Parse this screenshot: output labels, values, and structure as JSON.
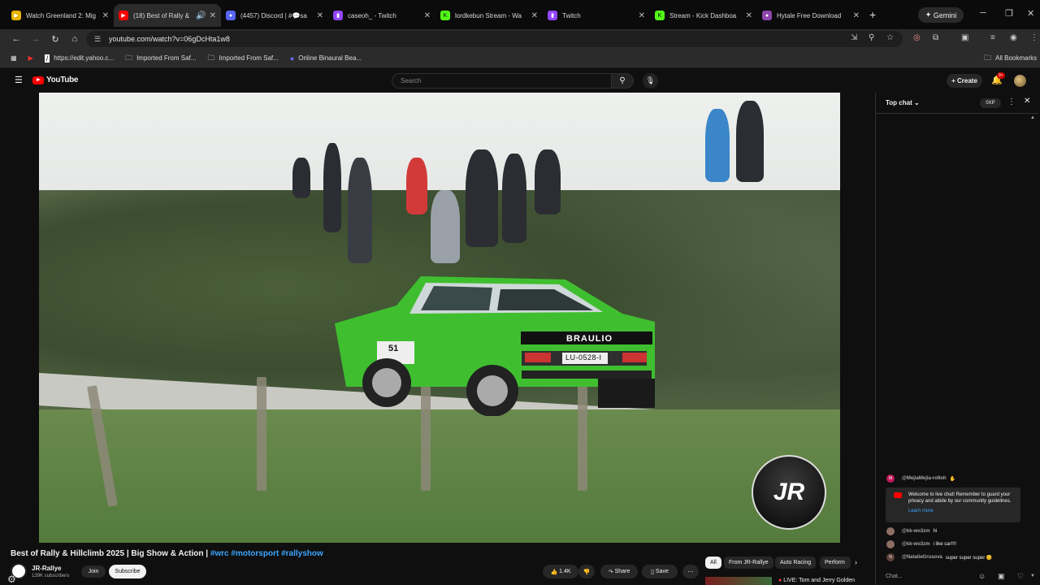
{
  "browser": {
    "tabs": [
      {
        "title": "Watch Greenland 2: Mig",
        "favicon_color": "#e8b400",
        "active": false
      },
      {
        "title": "(18) Best of Rally &",
        "favicon_color": "#ff0000",
        "active": true
      },
      {
        "title": "(4457) Discord | #💬sa",
        "favicon_color": "#5865f2",
        "active": false
      },
      {
        "title": "caseoh_ - Twitch",
        "favicon_color": "#9146ff",
        "active": false
      },
      {
        "title": "lordkebun Stream - Wa",
        "favicon_color": "#53fc18",
        "active": false
      },
      {
        "title": "Twitch",
        "favicon_color": "#9146ff",
        "active": false
      },
      {
        "title": "Stream - Kick Dashboa",
        "favicon_color": "#53fc18",
        "active": false
      },
      {
        "title": "Hytale Free Download",
        "favicon_color": "#8e44ad",
        "active": false
      }
    ],
    "gemini_label": "Gemini",
    "url": "youtube.com/watch?v=06gDcHta1w8",
    "bookmarks": [
      {
        "label": "https://edit.yahoo.c..."
      },
      {
        "label": "Imported From Saf..."
      },
      {
        "label": "Imported From Saf..."
      },
      {
        "label": "Online Binaural Bea..."
      }
    ],
    "all_bookmarks_label": "All Bookmarks"
  },
  "youtube": {
    "logo_text": "YouTube",
    "search_placeholder": "Search",
    "create_label": "Create",
    "notification_count": "9+"
  },
  "video": {
    "title": "Best of Rally & Hillclimb 2025 | Big Show & Action |",
    "hashtags": "#wrc #motorsport #rallyshow",
    "channel_name": "JR-Rallye",
    "subscribers": "139K subscribers",
    "join_label": "Join",
    "subscribe_label": "Subscribe",
    "likes": "1.4K",
    "share_label": "Share",
    "save_label": "Save",
    "car_plate": "LU-0528-I",
    "car_number": "51",
    "car_sponsor": "BRAULIO",
    "watermark": "JR",
    "accent_color": "#3ea6ff"
  },
  "chips": [
    "All",
    "From JR-Rallye",
    "Auto Racing",
    "Perform"
  ],
  "next_video": "LIVE: Tom and Jerry Golden",
  "chat": {
    "header": "Top chat",
    "xp": "0XP",
    "messages": [
      {
        "author": "@MejiaMejia-ro9oh",
        "text": "",
        "color": "#c2185b",
        "initial": "M"
      },
      {
        "author": "@kk-wo3zm",
        "text": "hi",
        "color": "#8d6e63",
        "initial": ""
      },
      {
        "author": "@kk-wo3zm",
        "text": "i like car!!!!",
        "color": "#8d6e63",
        "initial": ""
      },
      {
        "author": "@NatalieGrusova",
        "text": "super super super 😊",
        "color": "#5d4037",
        "initial": "N"
      }
    ],
    "welcome_text": "Welcome to live chat! Remember to guard your privacy and abide by our community guidelines.",
    "learn_more": "Learn more",
    "input_placeholder": "Chat..."
  }
}
